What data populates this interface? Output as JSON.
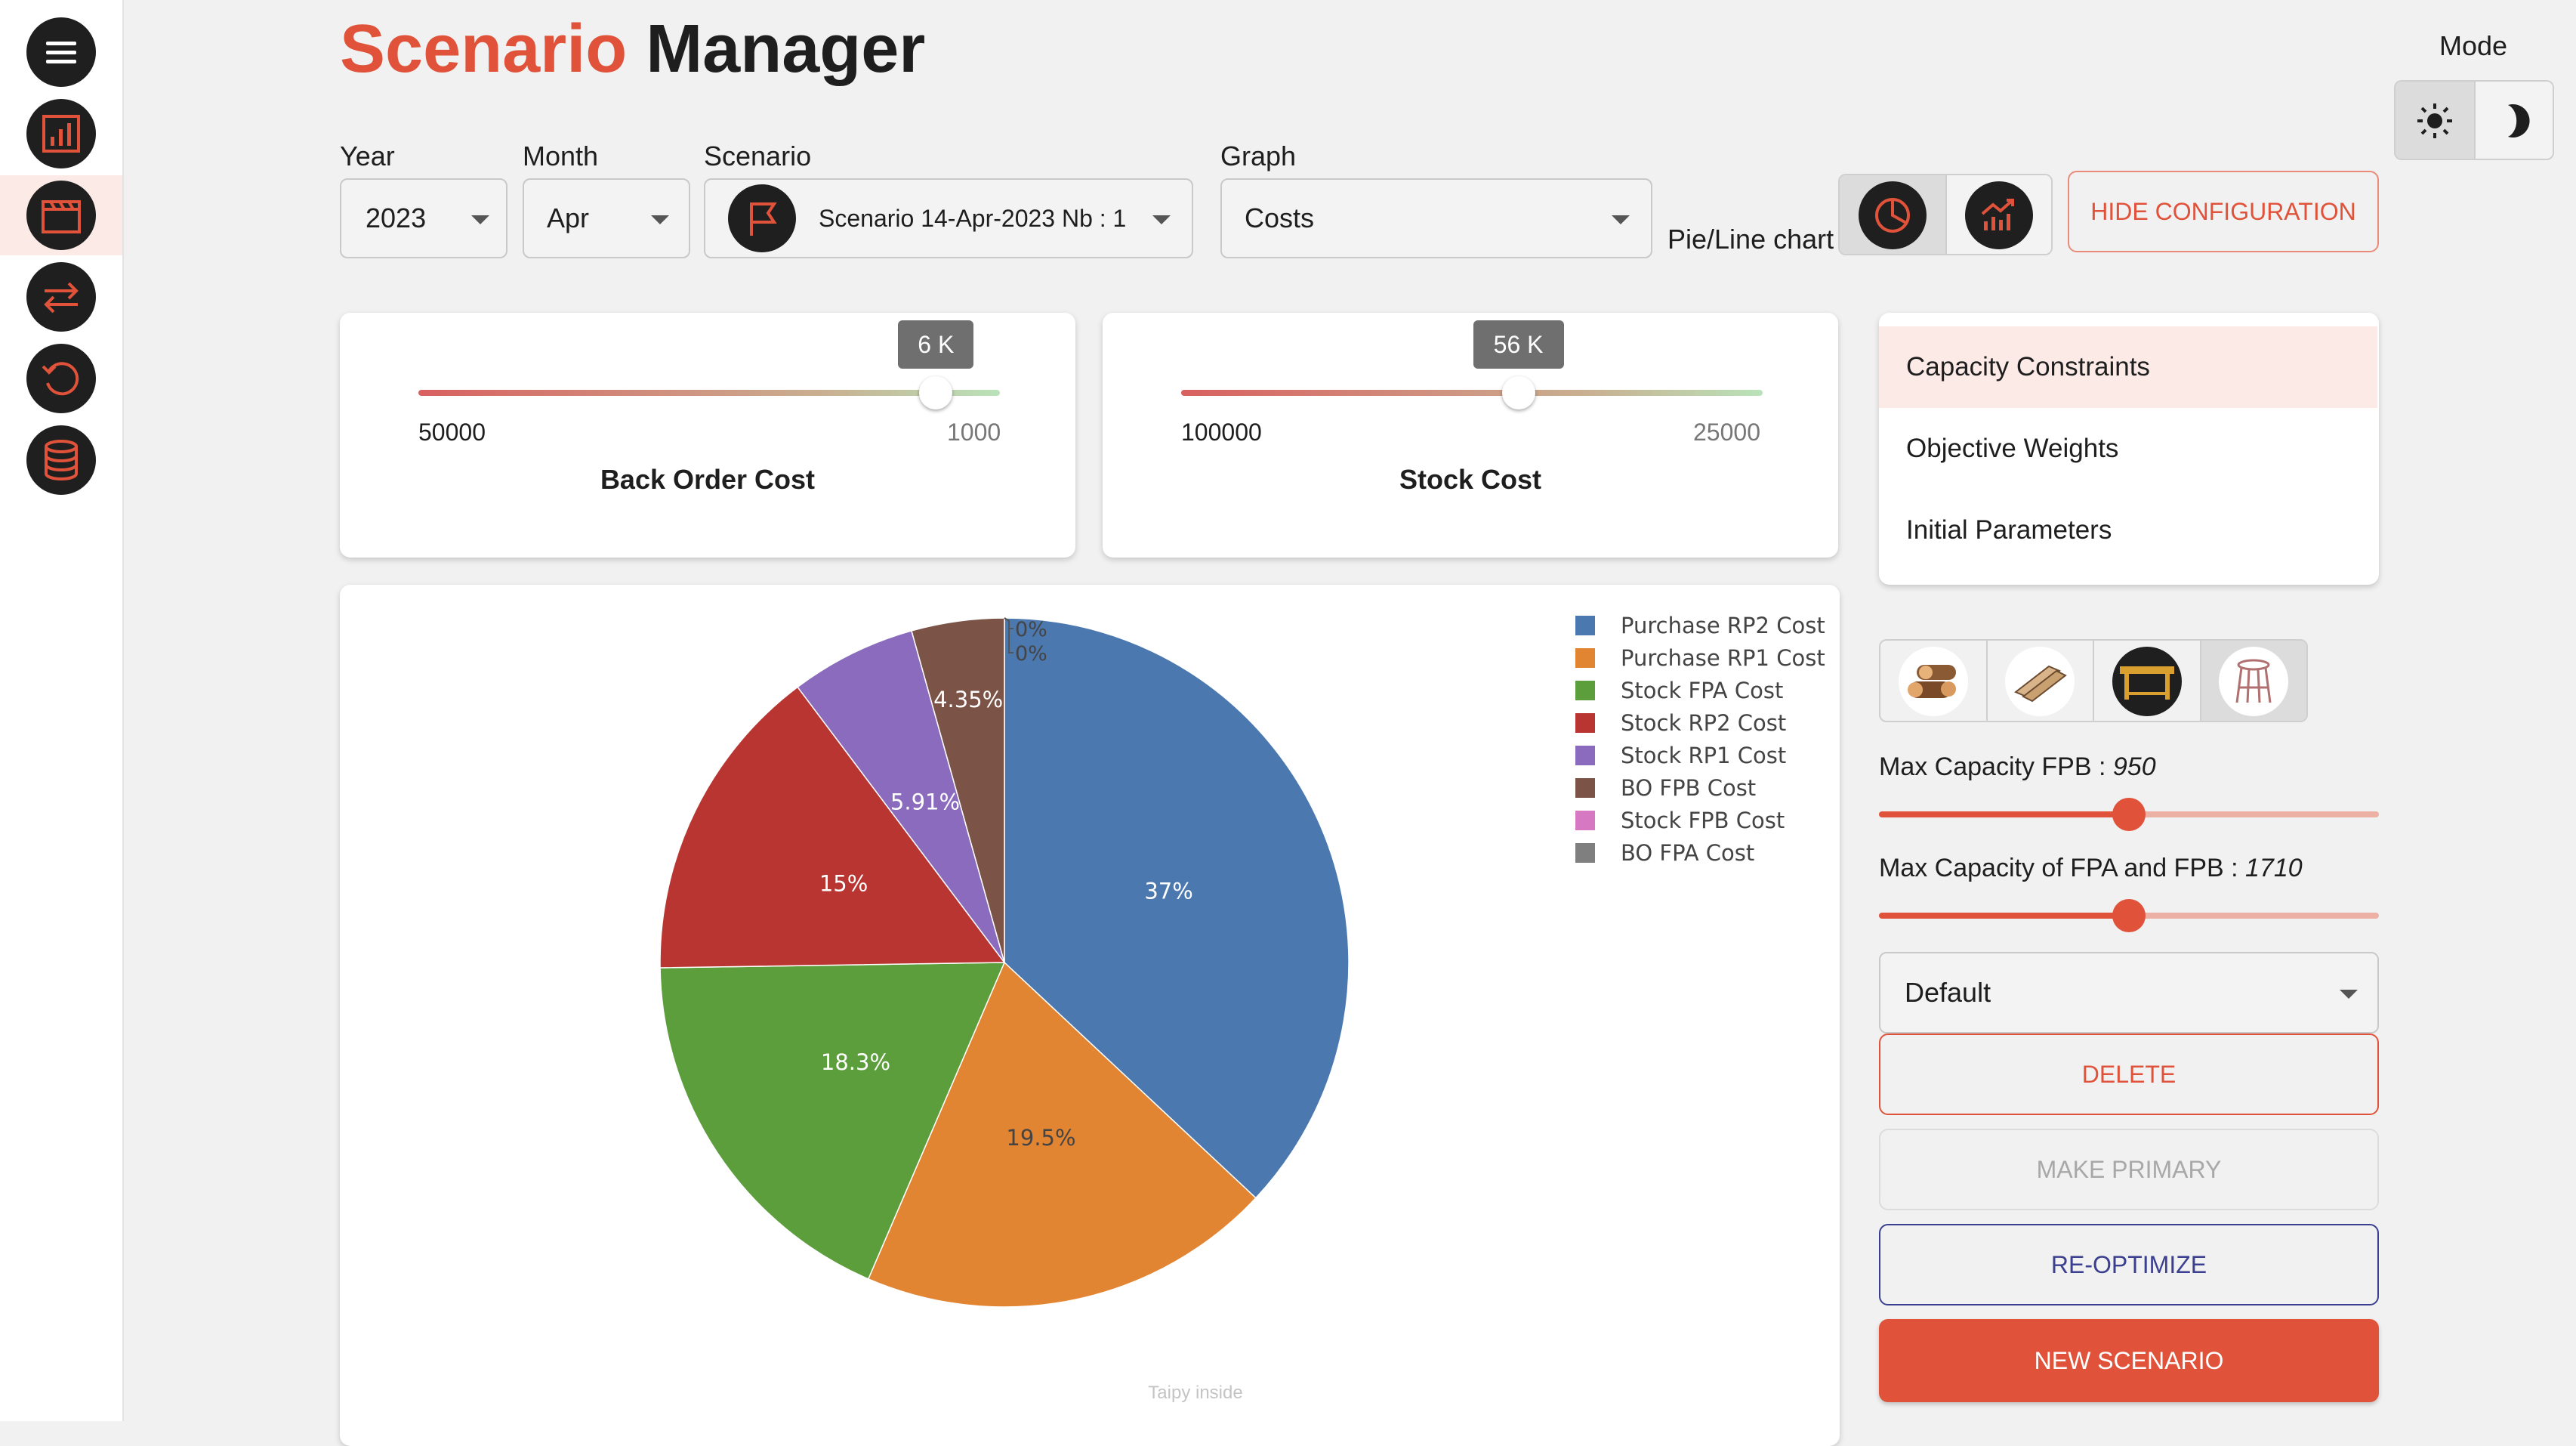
{
  "header": {
    "title_accent": "Scenario",
    "title_rest": "Manager",
    "mode_label": "Mode"
  },
  "filters": {
    "year": {
      "label": "Year",
      "value": "2023"
    },
    "month": {
      "label": "Month",
      "value": "Apr"
    },
    "scenario": {
      "label": "Scenario",
      "value": "Scenario 14-Apr-2023 Nb : 1"
    },
    "graph": {
      "label": "Graph",
      "value": "Costs"
    },
    "chart_toggle_label": "Pie/Line chart",
    "hide_config": "HIDE CONFIGURATION"
  },
  "sliders": {
    "back_order": {
      "title": "Back Order Cost",
      "min_label": "50000",
      "max_label": "1000",
      "bubble": "6 K",
      "fraction": 0.89
    },
    "stock": {
      "title": "Stock Cost",
      "min_label": "100000",
      "max_label": "25000",
      "bubble": "56 K",
      "fraction": 0.58
    }
  },
  "config_menu": {
    "items": [
      "Capacity Constraints",
      "Objective Weights",
      "Initial Parameters"
    ]
  },
  "product_icons": [
    "logs-icon",
    "planks-icon",
    "table-icon",
    "stool-icon"
  ],
  "capacity": {
    "fpb": {
      "label": "Max Capacity FPB : ",
      "value": "950",
      "fraction": 0.5
    },
    "fpa_fpb": {
      "label": "Max Capacity of FPA and FPB : ",
      "value": "1710",
      "fraction": 0.5
    }
  },
  "actions": {
    "select_value": "Default",
    "delete": "DELETE",
    "make_primary": "MAKE PRIMARY",
    "reoptimize": "RE-OPTIMIZE",
    "new_scenario": "NEW SCENARIO"
  },
  "footer": {
    "watermark": "Taipy inside"
  },
  "colors": {
    "accent": "#e0533a",
    "dark": "#1f1f1f",
    "navy": "#3a3f8f"
  },
  "chart_data": {
    "type": "pie",
    "legend_position": "top-right",
    "slices": [
      {
        "name": "Purchase RP2 Cost",
        "value": 37,
        "label": "37%",
        "color": "#4c78b0"
      },
      {
        "name": "Purchase RP1 Cost",
        "value": 19.5,
        "label": "19.5%",
        "color": "#e28533"
      },
      {
        "name": "Stock FPA Cost",
        "value": 18.3,
        "label": "18.3%",
        "color": "#5c9e3c"
      },
      {
        "name": "Stock RP2 Cost",
        "value": 15,
        "label": "15%",
        "color": "#b93532"
      },
      {
        "name": "Stock RP1 Cost",
        "value": 5.91,
        "label": "5.91%",
        "color": "#8b6bbd"
      },
      {
        "name": "BO FPB Cost",
        "value": 4.35,
        "label": "4.35%",
        "color": "#7b5347"
      },
      {
        "name": "Stock FPB Cost",
        "value": 0,
        "label": "0%",
        "color": "#d679c2"
      },
      {
        "name": "BO FPA Cost",
        "value": 0,
        "label": "0%",
        "color": "#7f7f7f"
      }
    ]
  }
}
